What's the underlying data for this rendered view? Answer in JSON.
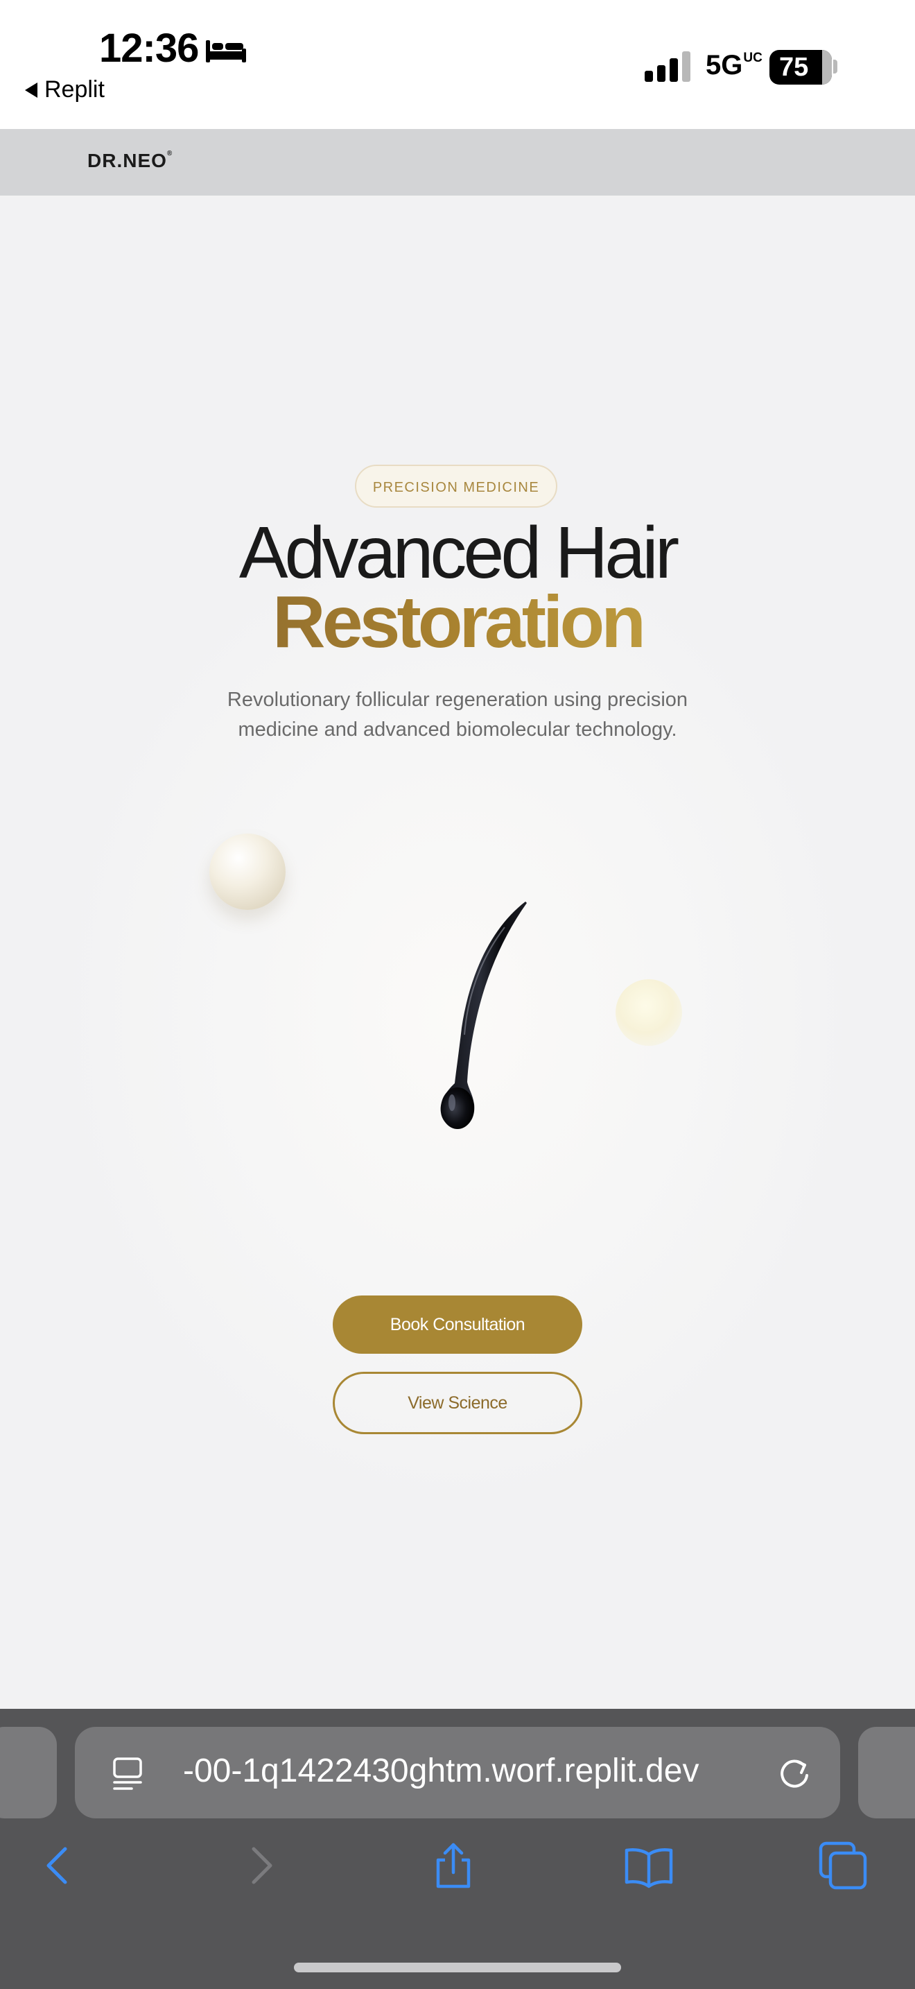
{
  "status_bar": {
    "time": "12:36",
    "back_app": "Replit",
    "network": "5G",
    "network_suffix": "UC",
    "battery": "75",
    "icons": [
      "bed-icon",
      "signal-bars-icon",
      "battery-icon"
    ]
  },
  "site": {
    "logo": "DR.NEO",
    "logo_mark": "®"
  },
  "hero": {
    "badge": "PRECISION MEDICINE",
    "headline_line1": "Advanced Hair",
    "headline_line2": "Restoration",
    "subtitle": "Revolutionary follicular regeneration using precision medicine and advanced biomolecular technology.",
    "primary_button": "Book Consultation",
    "secondary_button": "View Science"
  },
  "colors": {
    "gold_accent": "#a88734",
    "gold_light": "#d9bd55",
    "gold_dark": "#7a5a2e",
    "header_bg": "#d3d4d6",
    "safari_bg": "#555557",
    "safari_icon_blue": "#3b8cf5"
  },
  "browser": {
    "url": "-00-1q1422430ghtm.worf.replit.dev",
    "toolbar_icons": [
      "back-icon",
      "forward-icon",
      "share-icon",
      "bookmarks-icon",
      "tabs-icon"
    ]
  }
}
